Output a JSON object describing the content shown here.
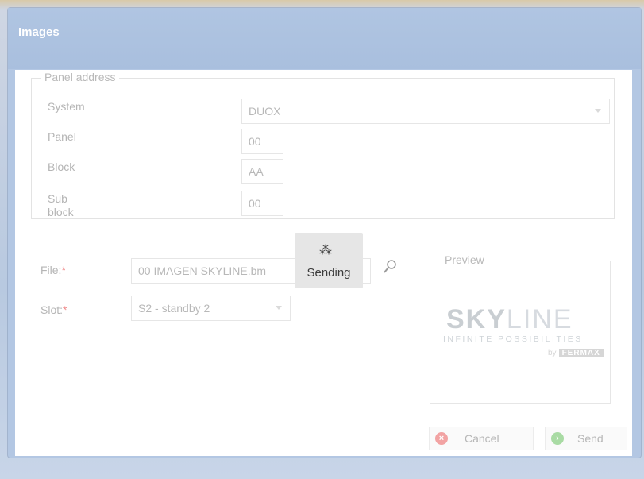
{
  "dialog": {
    "title": "Images"
  },
  "panel_address": {
    "legend": "Panel address",
    "system": {
      "label": "System",
      "value": "DUOX"
    },
    "panel": {
      "label": "Panel",
      "value": "00"
    },
    "block": {
      "label": "Block",
      "value": "AA"
    },
    "sub_block": {
      "label_line1": "Sub",
      "label_line2": "block",
      "value": "00"
    }
  },
  "file": {
    "label": "File:",
    "required_mark": "*",
    "value": "00 IMAGEN SKYLINE.bm"
  },
  "slot": {
    "label": "Slot:",
    "required_mark": "*",
    "value": "S2 - standby 2"
  },
  "sending": {
    "label": "Sending"
  },
  "preview": {
    "legend": "Preview",
    "logo_bold": "SKY",
    "logo_light": "LINE",
    "logo_sub": "INFINITE POSSIBILITIES",
    "logo_by": "by",
    "logo_brand": "FERMAX"
  },
  "buttons": {
    "cancel": "Cancel",
    "send": "Send"
  },
  "colors": {
    "cancel_icon": "#f2a3a3",
    "send_icon": "#a9dba4"
  }
}
